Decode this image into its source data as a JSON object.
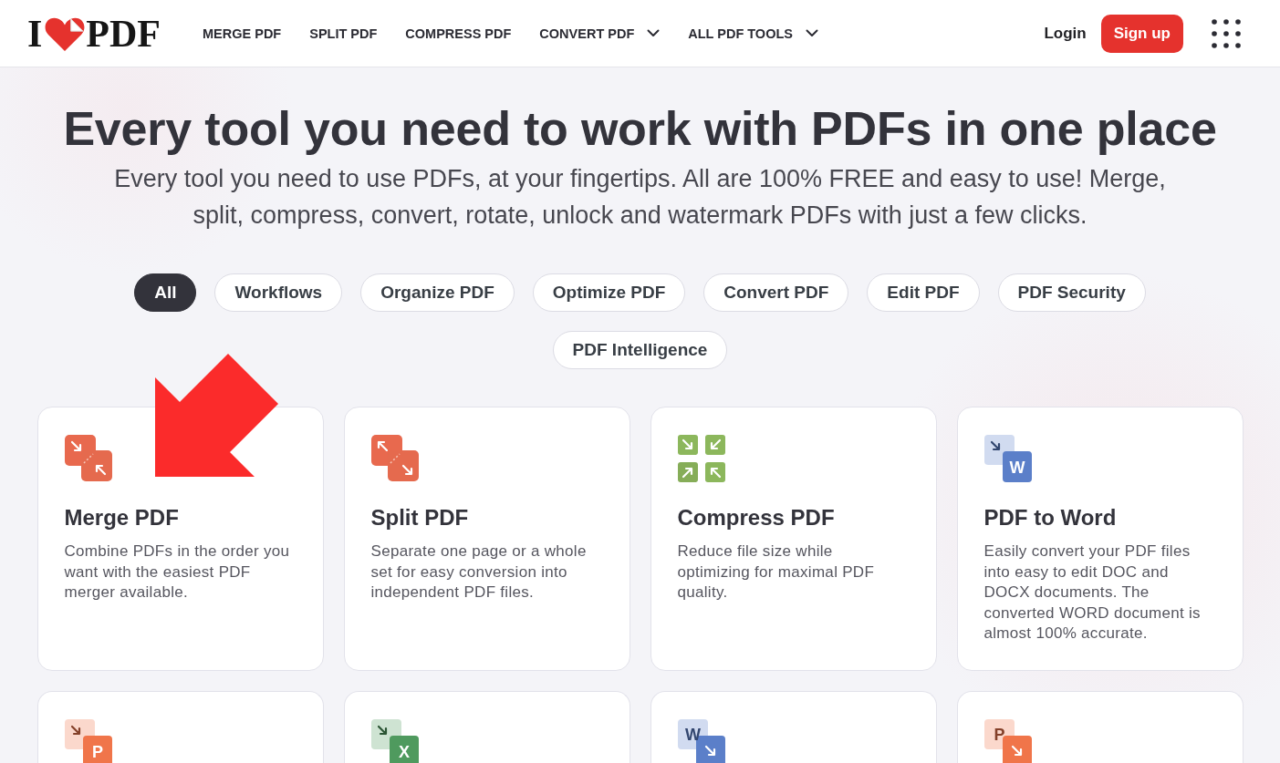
{
  "header": {
    "logo": {
      "before": "I",
      "after": "PDF"
    },
    "nav": [
      {
        "label": "MERGE PDF",
        "dropdown": false
      },
      {
        "label": "SPLIT PDF",
        "dropdown": false
      },
      {
        "label": "COMPRESS PDF",
        "dropdown": false
      },
      {
        "label": "CONVERT PDF",
        "dropdown": true
      },
      {
        "label": "ALL PDF TOOLS",
        "dropdown": true
      }
    ],
    "login": "Login",
    "signup": "Sign up"
  },
  "hero": {
    "title": "Every tool you need to work with PDFs in one place",
    "subtitle": "Every tool you need to use PDFs, at your fingertips. All are 100% FREE and easy to use! Merge, split, compress, convert, rotate, unlock and watermark PDFs with just a few clicks."
  },
  "filters": [
    {
      "label": "All",
      "selected": true
    },
    {
      "label": "Workflows",
      "selected": false
    },
    {
      "label": "Organize PDF",
      "selected": false
    },
    {
      "label": "Optimize PDF",
      "selected": false
    },
    {
      "label": "Convert PDF",
      "selected": false
    },
    {
      "label": "Edit PDF",
      "selected": false
    },
    {
      "label": "PDF Security",
      "selected": false
    },
    {
      "label": "PDF Intelligence",
      "selected": false
    }
  ],
  "cards": [
    {
      "icon": {
        "kind": "merge"
      },
      "title": "Merge PDF",
      "description": "Combine PDFs in the order you want with the easiest PDF merger available."
    },
    {
      "icon": {
        "kind": "split"
      },
      "title": "Split PDF",
      "description": "Separate one page or a whole set for easy conversion into independent PDF files."
    },
    {
      "icon": {
        "kind": "compress"
      },
      "title": "Compress PDF",
      "description": "Reduce file size while optimizing for maximal PDF quality."
    },
    {
      "icon": {
        "kind": "from-pdf",
        "color": "#5b7fc9",
        "letter": "W"
      },
      "title": "PDF to Word",
      "description": "Easily convert your PDF files into easy to edit DOC and DOCX documents. The converted WORD document is almost 100% accurate."
    },
    {
      "icon": {
        "kind": "from-pdf",
        "color": "#f0754a",
        "letter": "P"
      }
    },
    {
      "icon": {
        "kind": "from-pdf",
        "color": "#4f9a5e",
        "letter": "X"
      }
    },
    {
      "icon": {
        "kind": "to-pdf",
        "color": "#5b7fc9",
        "letter": "W"
      }
    },
    {
      "icon": {
        "kind": "to-pdf",
        "color": "#f0754a",
        "letter": "P"
      }
    }
  ],
  "annotation": {
    "kind": "arrow"
  }
}
